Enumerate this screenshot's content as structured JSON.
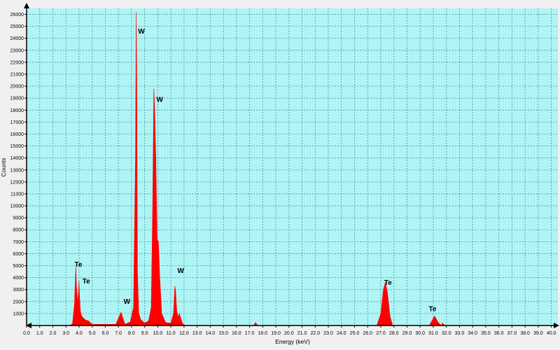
{
  "chart_data": {
    "type": "area",
    "title": "",
    "xlabel": "Energy (keV)",
    "ylabel": "Counts",
    "xlim": [
      0,
      40.5
    ],
    "ylim": [
      0,
      26500
    ],
    "x_ticks": [
      0.0,
      1.0,
      2.0,
      3.0,
      4.0,
      5.0,
      6.0,
      7.0,
      8.0,
      9.0,
      10.0,
      11.0,
      12.0,
      13.0,
      14.0,
      15.0,
      16.0,
      17.0,
      18.0,
      19.0,
      20.0,
      21.0,
      22.0,
      23.0,
      24.0,
      25.0,
      26.0,
      27.0,
      28.0,
      29.0,
      30.0,
      31.0,
      32.0,
      33.0,
      34.0,
      35.0,
      36.0,
      37.0,
      38.0,
      39.0,
      40.0
    ],
    "y_ticks": [
      1000,
      2000,
      3000,
      4000,
      5000,
      6000,
      7000,
      8000,
      9000,
      10000,
      11000,
      12000,
      13000,
      14000,
      15000,
      16000,
      17000,
      18000,
      19000,
      20000,
      21000,
      22000,
      23000,
      24000,
      25000,
      26000
    ],
    "grid": true,
    "background_color": "#aff5f5",
    "series_color": "#ff0000",
    "series": [
      {
        "x": [
          0,
          3.3,
          3.5,
          3.65,
          3.75,
          3.8,
          3.9,
          4.0,
          4.03,
          4.1,
          4.2,
          4.3,
          4.5,
          4.7,
          4.8,
          5.0,
          6.8,
          7.2,
          7.35,
          7.5,
          7.9,
          8.15,
          8.3,
          8.35,
          8.4,
          8.45,
          8.55,
          8.7,
          9.0,
          9.3,
          9.5,
          9.6,
          9.7,
          9.75,
          9.85,
          9.95,
          10.05,
          10.15,
          10.3,
          10.6,
          11.0,
          11.2,
          11.3,
          11.35,
          11.45,
          11.55,
          11.65,
          11.75,
          11.9,
          12.1,
          17.3,
          17.45,
          17.6,
          26.7,
          27.0,
          27.2,
          27.35,
          27.5,
          27.7,
          27.9,
          30.7,
          30.95,
          31.1,
          31.35,
          31.6,
          31.7,
          31.9,
          40.5
        ],
        "y": [
          0,
          0,
          150,
          1800,
          4900,
          3300,
          1800,
          3700,
          2600,
          1200,
          800,
          650,
          450,
          400,
          300,
          100,
          100,
          1100,
          600,
          100,
          300,
          1500,
          14000,
          26200,
          20000,
          4500,
          1000,
          500,
          200,
          400,
          1500,
          9000,
          19800,
          18500,
          14000,
          7200,
          7000,
          4000,
          1000,
          250,
          200,
          1000,
          3300,
          3000,
          1200,
          700,
          1000,
          600,
          150,
          0,
          0,
          250,
          0,
          0,
          1000,
          3000,
          3600,
          2800,
          800,
          0,
          0,
          500,
          800,
          300,
          0,
          200,
          0,
          0
        ]
      }
    ],
    "annotations": [
      {
        "text": "W",
        "x": 8.75,
        "y": 24400
      },
      {
        "text": "W",
        "x": 10.15,
        "y": 18700
      },
      {
        "text": "W",
        "x": 11.75,
        "y": 4400
      },
      {
        "text": "W",
        "x": 7.65,
        "y": 1800
      },
      {
        "text": "Te",
        "x": 3.95,
        "y": 4900
      },
      {
        "text": "Te",
        "x": 4.55,
        "y": 3500
      },
      {
        "text": "Te",
        "x": 27.55,
        "y": 3400
      },
      {
        "text": "Te",
        "x": 30.95,
        "y": 1200
      }
    ]
  }
}
